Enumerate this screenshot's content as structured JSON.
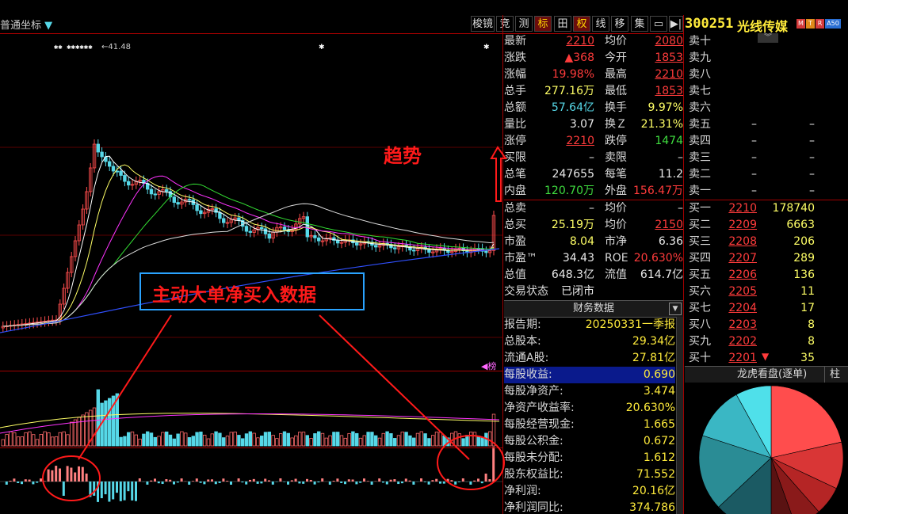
{
  "toolbar": {
    "coord_label": "普通坐标",
    "buttons": [
      "梭镜",
      "竞",
      "测",
      "标",
      "田",
      "权",
      "线",
      "移",
      "集",
      "▭",
      "▶|"
    ]
  },
  "stock": {
    "code": "300251",
    "name": "光线传媒",
    "badges": [
      "M",
      "T",
      "R",
      "A50"
    ]
  },
  "quote_left": [
    {
      "label": "最新",
      "value": "2210",
      "color": "red"
    },
    {
      "label": "涨跌",
      "value": "▲368",
      "color": "red"
    },
    {
      "label": "涨幅",
      "value": "19.98%",
      "color": "red"
    },
    {
      "label": "总手",
      "value": "277.16万",
      "color": "yellow"
    },
    {
      "label": "总额",
      "value": "57.64亿",
      "color": "cyan"
    },
    {
      "label": "量比",
      "value": "3.07",
      "color": "white"
    },
    {
      "label": "涨停",
      "value": "2210",
      "color": "red"
    },
    {
      "label": "买限",
      "value": "–",
      "color": "white"
    },
    {
      "label": "总笔",
      "value": "247655",
      "color": "white"
    },
    {
      "label": "内盘",
      "value": "120.70万",
      "color": "green"
    }
  ],
  "quote_right": [
    {
      "label": "均价",
      "value": "2080",
      "color": "red"
    },
    {
      "label": "今开",
      "value": "1853",
      "color": "red"
    },
    {
      "label": "最高",
      "value": "2210",
      "color": "red"
    },
    {
      "label": "最低",
      "value": "1853",
      "color": "red"
    },
    {
      "label": "换手",
      "value": "9.97%",
      "color": "yellow"
    },
    {
      "label": "换Ｚ",
      "value": "21.31%",
      "color": "yellow"
    },
    {
      "label": "跌停",
      "value": "1474",
      "color": "green"
    },
    {
      "label": "卖限",
      "value": "–",
      "color": "white"
    },
    {
      "label": "每笔",
      "value": "11.2",
      "color": "white"
    },
    {
      "label": "外盘",
      "value": "156.47万",
      "color": "red"
    }
  ],
  "quote_extra_left": [
    {
      "label": "总卖",
      "value": "–",
      "color": "white"
    },
    {
      "label": "总买",
      "value": "25.19万",
      "color": "yellow"
    },
    {
      "label": "市盈",
      "value": "8.04",
      "color": "yellow"
    },
    {
      "label": "市盈™",
      "value": "34.43",
      "color": "white"
    },
    {
      "label": "总值",
      "value": "648.3亿",
      "color": "white"
    },
    {
      "label": "交易状态",
      "value": "已闭市",
      "color": "white"
    }
  ],
  "quote_extra_right": [
    {
      "label": "均价",
      "value": "–",
      "color": "white"
    },
    {
      "label": "均价",
      "value": "2150",
      "color": "red"
    },
    {
      "label": "市净",
      "value": "6.36",
      "color": "white"
    },
    {
      "label": "ROE",
      "value": "20.630%",
      "color": "red"
    },
    {
      "label": "流值",
      "value": "614.7亿",
      "color": "white"
    }
  ],
  "order_book_sell": [
    {
      "label": "卖十",
      "price": "",
      "vol": ""
    },
    {
      "label": "卖九",
      "price": "",
      "vol": ""
    },
    {
      "label": "卖八",
      "price": "",
      "vol": ""
    },
    {
      "label": "卖七",
      "price": "",
      "vol": ""
    },
    {
      "label": "卖六",
      "price": "",
      "vol": ""
    },
    {
      "label": "卖五",
      "price": "–",
      "vol": "–"
    },
    {
      "label": "卖四",
      "price": "–",
      "vol": "–"
    },
    {
      "label": "卖三",
      "price": "–",
      "vol": "–"
    },
    {
      "label": "卖二",
      "price": "–",
      "vol": "–"
    },
    {
      "label": "卖一",
      "price": "–",
      "vol": "–"
    }
  ],
  "order_book_buy": [
    {
      "label": "买一",
      "price": "2210",
      "vol": "178740"
    },
    {
      "label": "买二",
      "price": "2209",
      "vol": "6663"
    },
    {
      "label": "买三",
      "price": "2208",
      "vol": "206"
    },
    {
      "label": "买四",
      "price": "2207",
      "vol": "289"
    },
    {
      "label": "买五",
      "price": "2206",
      "vol": "136"
    },
    {
      "label": "买六",
      "price": "2205",
      "vol": "11"
    },
    {
      "label": "买七",
      "price": "2204",
      "vol": "17"
    },
    {
      "label": "买八",
      "price": "2203",
      "vol": "8"
    },
    {
      "label": "买九",
      "price": "2202",
      "vol": "8"
    },
    {
      "label": "买十",
      "price": "2201",
      "vol": "35"
    }
  ],
  "finance": {
    "header": "财务数据",
    "rows": [
      {
        "label": "报告期:",
        "value": "20250331一季报"
      },
      {
        "label": "总股本:",
        "value": "29.34亿"
      },
      {
        "label": "流通A股:",
        "value": "27.81亿"
      },
      {
        "label": "每股收益:",
        "value": "0.690"
      },
      {
        "label": "每股净资产:",
        "value": "3.474"
      },
      {
        "label": "净资产收益率:",
        "value": "20.630%"
      },
      {
        "label": "每股经营现金:",
        "value": "1.665"
      },
      {
        "label": "每股公积金:",
        "value": "0.672"
      },
      {
        "label": "每股未分配:",
        "value": "1.612"
      },
      {
        "label": "股东权益比:",
        "value": "71.552"
      },
      {
        "label": "净利润:",
        "value": "20.16亿"
      },
      {
        "label": "净利润同比:",
        "value": "374.786"
      }
    ]
  },
  "lhb": {
    "header": "龙虎看盘(逐单)",
    "tab2": "柱"
  },
  "pie_colors": [
    "#ff4d4d",
    "#d93636",
    "#b52525",
    "#8a1a1a",
    "#5a1212",
    "#1b5a63",
    "#2a8c95",
    "#3ab7c4",
    "#4fe0ea"
  ],
  "pie_values": [
    0.215,
    0.105,
    0.065,
    0.06,
    0.055,
    0.13,
    0.17,
    0.12,
    0.08
  ],
  "chart": {
    "max_label": "41.48",
    "peak_marks": "✱✱ ✱✱✱✱✱✱",
    "rank_tag": "榜",
    "volume_colors": {
      "up": "#ff6b6b",
      "down": "#56d8e8"
    }
  },
  "annotations": {
    "trend": "趋势",
    "main_box": "主动大单净买入数据"
  }
}
